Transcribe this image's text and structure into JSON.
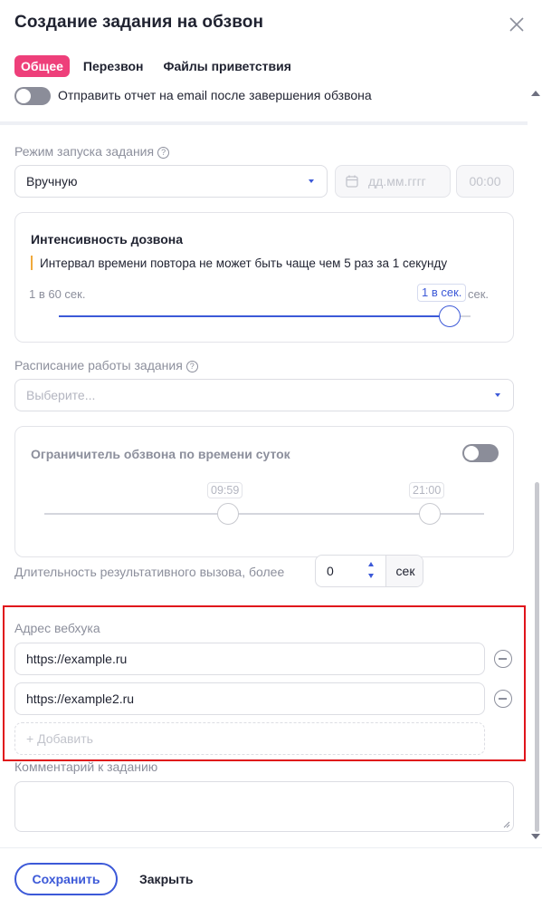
{
  "header": {
    "title": "Создание задания на обзвон"
  },
  "tabs": [
    {
      "label": "Общее",
      "active": true
    },
    {
      "label": "Перезвон",
      "active": false
    },
    {
      "label": "Файлы приветствия",
      "active": false
    }
  ],
  "report": {
    "label": "Отправить отчет на email после завершения обзвона",
    "enabled": false
  },
  "launch_mode": {
    "label": "Режим запуска задания",
    "help": "?",
    "value": "Вручную",
    "date_placeholder": "дд.мм.гггг",
    "time_placeholder": "00:00"
  },
  "intensity": {
    "title": "Интенсивность дозвона",
    "note": "Интервал времени повтора не может быть чаще чем 5 раз за 1 секунду",
    "min_label": "1 в 60 сек.",
    "max_label": "сек.",
    "value_label": "1 в сек.",
    "level_fraction": 0.95
  },
  "schedule": {
    "label": "Расписание работы задания",
    "help": "?",
    "placeholder": "Выберите..."
  },
  "time_limit": {
    "title": "Ограничитель обзвона по времени суток",
    "enabled": false,
    "start": "09:59",
    "end": "21:00"
  },
  "duration": {
    "label": "Длительность результативного вызова, более",
    "value": "0",
    "unit": "сек"
  },
  "webhook": {
    "label": "Адрес вебхука",
    "urls": [
      "https://example.ru",
      "https://example2.ru"
    ],
    "add_label": "+ Добавить"
  },
  "comment": {
    "label": "Комментарий к заданию",
    "value": ""
  },
  "footer": {
    "save_label": "Сохранить",
    "close_label": "Закрыть"
  },
  "colors": {
    "accent": "#3c59d8",
    "tab_active": "#ee3f7a",
    "highlight": "#e0141b",
    "note_bar": "#f0a93b"
  }
}
